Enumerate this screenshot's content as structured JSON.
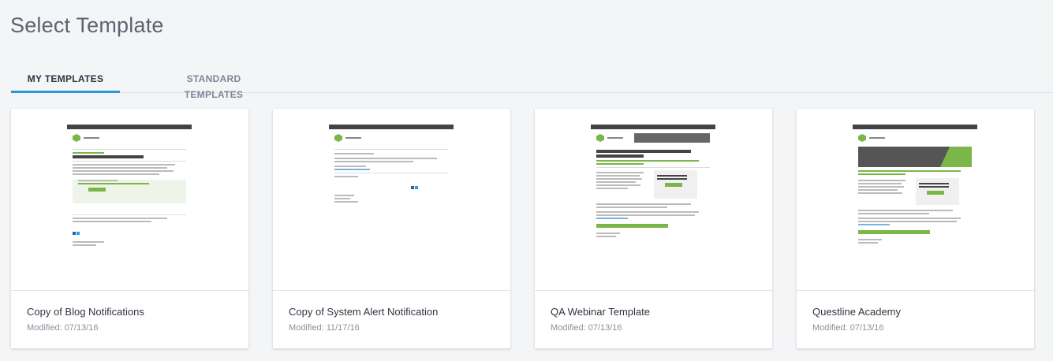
{
  "page": {
    "title": "Select Template"
  },
  "tabs": [
    {
      "label": "MY TEMPLATES",
      "active": true
    },
    {
      "label": "STANDARD TEMPLATES",
      "active": false
    }
  ],
  "templates": [
    {
      "name": "Copy of Blog Notifications",
      "modified": "Modified: 07/13/16"
    },
    {
      "name": "Copy of System Alert Notification",
      "modified": "Modified: 11/17/16"
    },
    {
      "name": "QA Webinar Template",
      "modified": "Modified: 07/13/16"
    },
    {
      "name": "Questline Academy",
      "modified": "Modified: 07/13/16"
    }
  ],
  "colors": {
    "accent": "#2a96d6",
    "brand_green": "#7ab648"
  }
}
